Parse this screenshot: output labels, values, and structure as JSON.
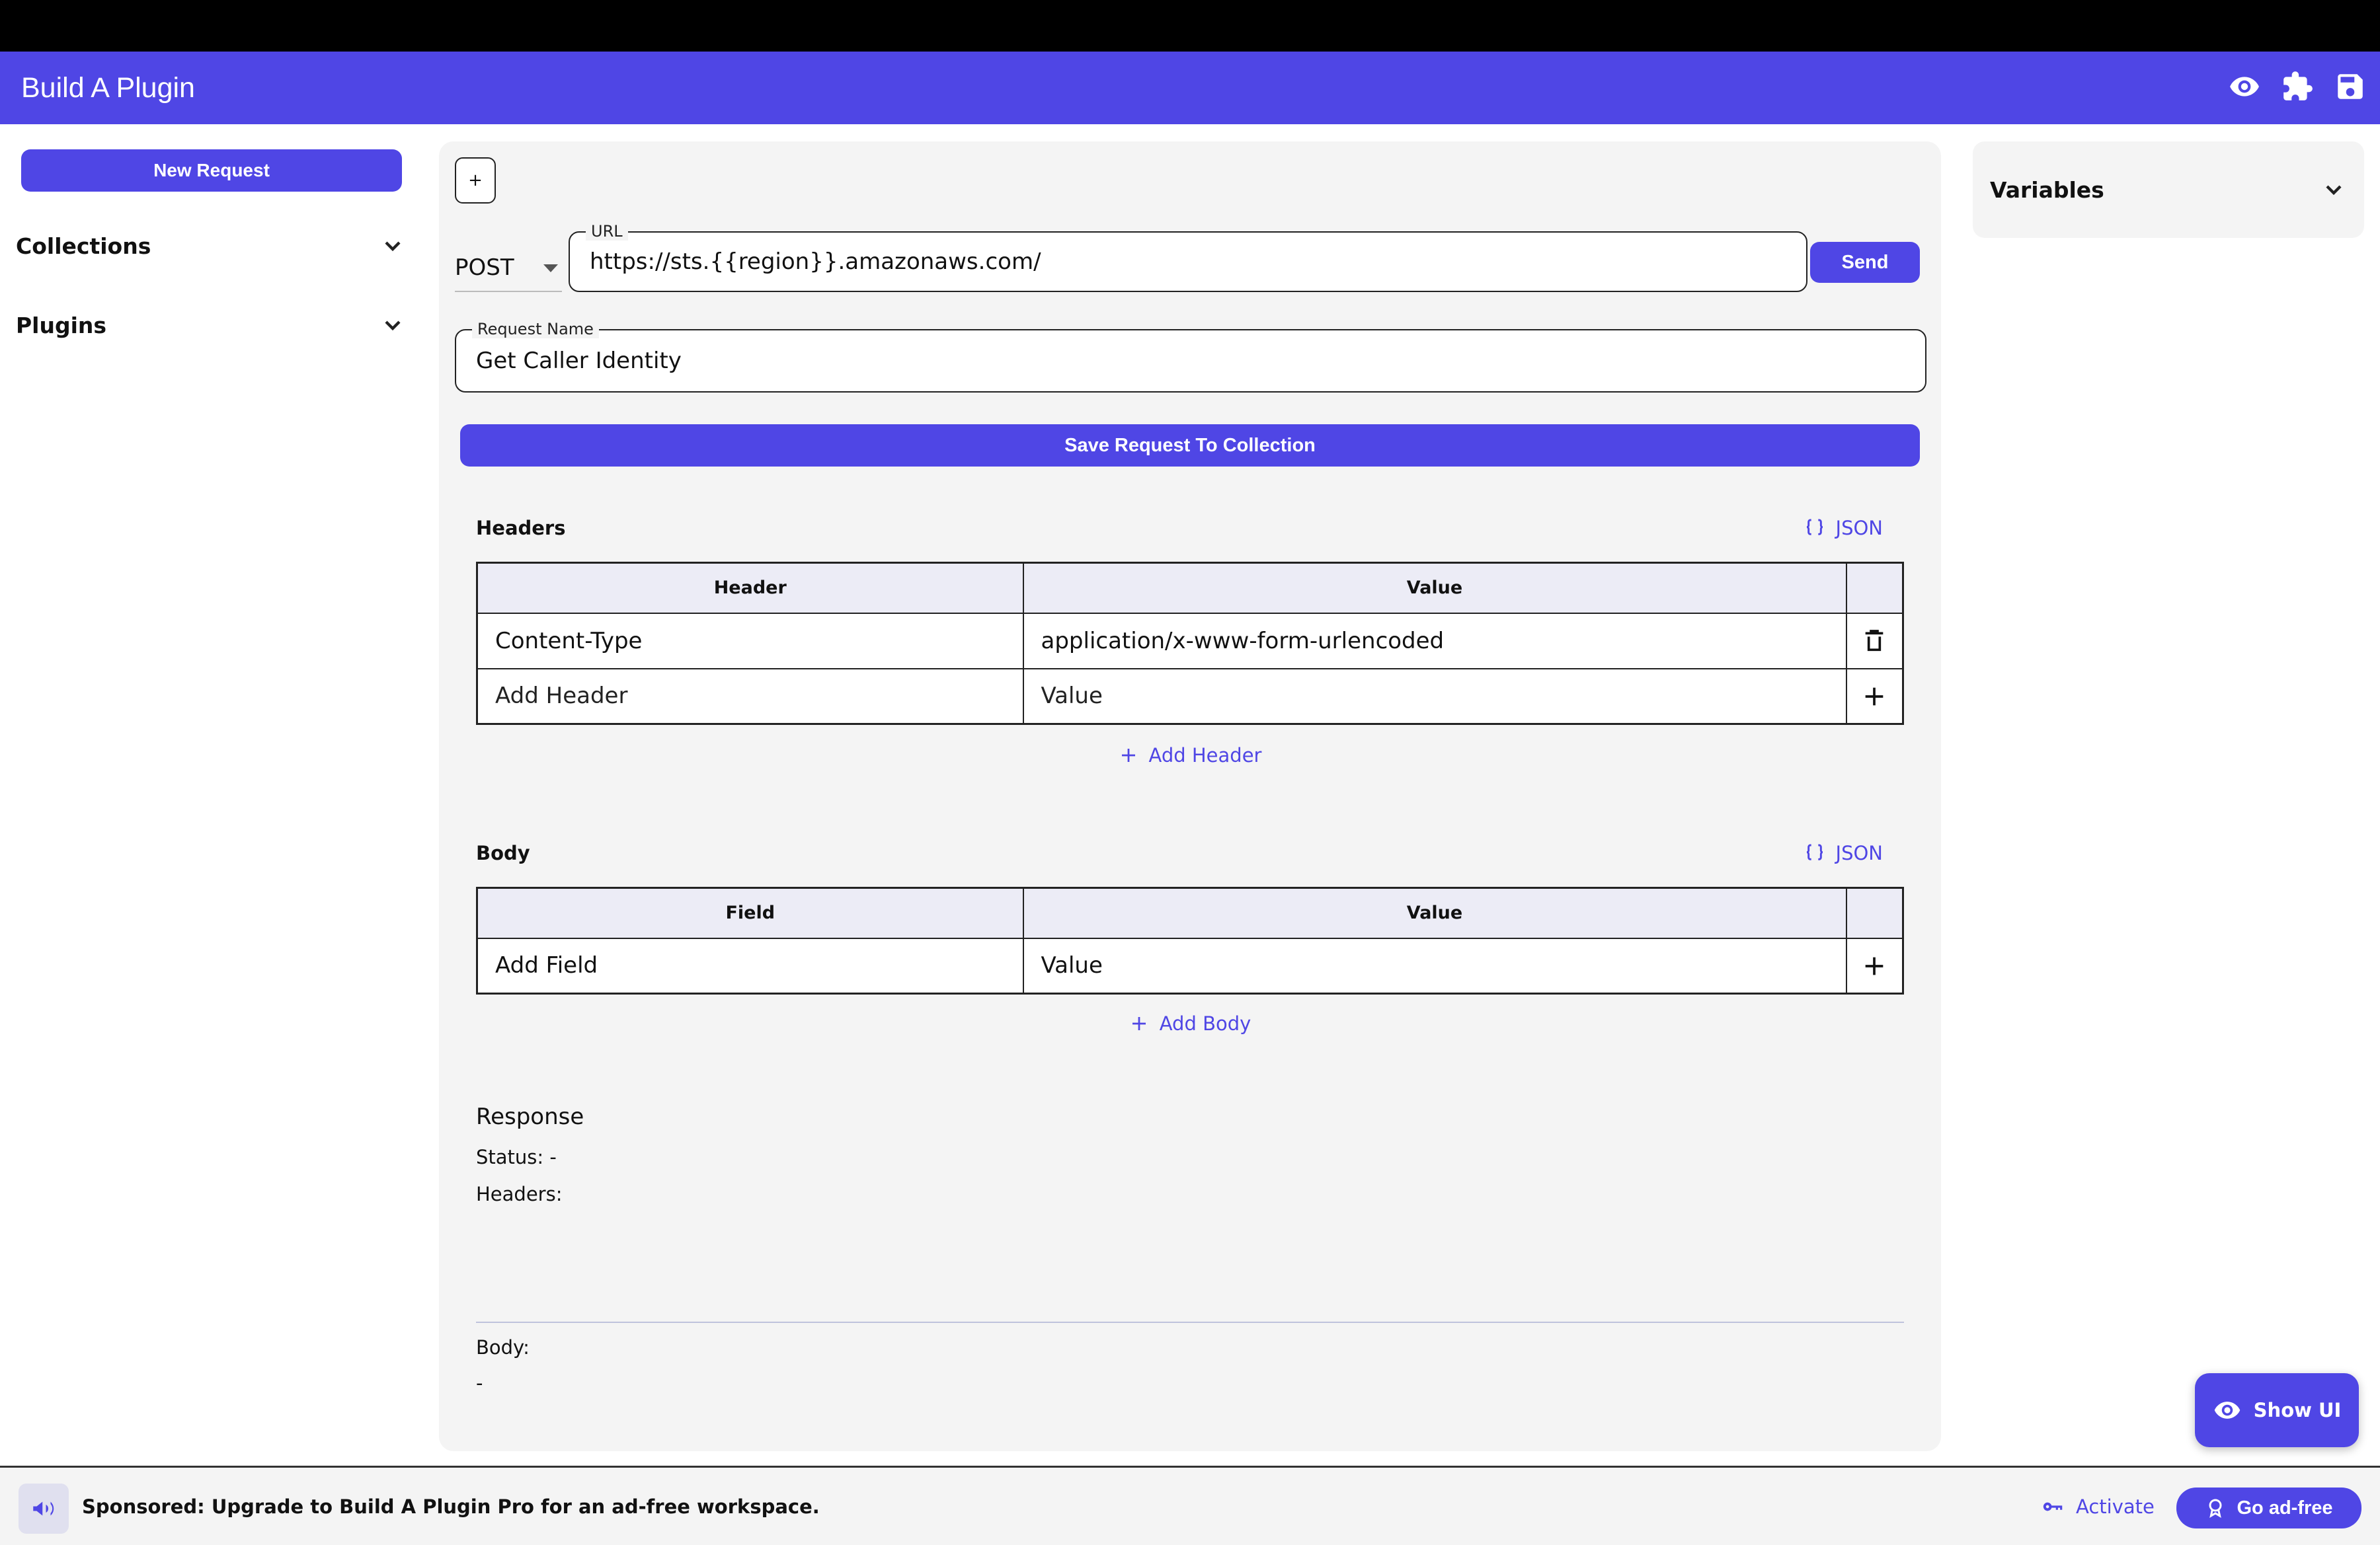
{
  "app": {
    "title": "Build A Plugin",
    "accent_color": "#4f46e5",
    "header_icons": [
      "eye-icon",
      "puzzle-icon",
      "save-icon"
    ]
  },
  "sidebar": {
    "new_request_label": "New Request",
    "sections": [
      {
        "label": "Collections",
        "icon": "chevron-down-icon"
      },
      {
        "label": "Plugins",
        "icon": "chevron-down-icon"
      }
    ]
  },
  "request": {
    "add_tab_label": "+",
    "method": "POST",
    "url_label": "URL",
    "url_value": "https://sts.{{region}}.amazonaws.com/",
    "send_label": "Send",
    "name_label": "Request Name",
    "name_value": "Get Caller Identity",
    "save_label": "Save Request To Collection"
  },
  "headers": {
    "title": "Headers",
    "json_label": "JSON",
    "columns": [
      "Header",
      "Value",
      ""
    ],
    "rows": [
      {
        "key": "Content-Type",
        "value": "application/x-www-form-urlencoded",
        "action_icon": "trash-icon"
      }
    ],
    "new_row": {
      "key_placeholder": "Add Header",
      "value_placeholder": "Value",
      "action_icon": "plus-icon"
    },
    "add_label": "Add Header"
  },
  "body": {
    "title": "Body",
    "json_label": "JSON",
    "columns": [
      "Field",
      "Value",
      ""
    ],
    "new_row": {
      "key_placeholder": "Add Field",
      "value_placeholder": "Value",
      "action_icon": "plus-icon"
    },
    "add_label": "Add Body"
  },
  "response": {
    "title": "Response",
    "status_line": "Status: -",
    "headers_label": "Headers:",
    "body_label": "Body:",
    "body_value": "-"
  },
  "variables": {
    "title": "Variables"
  },
  "show_ui_label": "Show UI",
  "footer": {
    "ad_text": "Sponsored: Upgrade to Build A Plugin Pro for an ad-free workspace.",
    "activate_label": "Activate",
    "go_ad_free_label": "Go ad-free"
  }
}
